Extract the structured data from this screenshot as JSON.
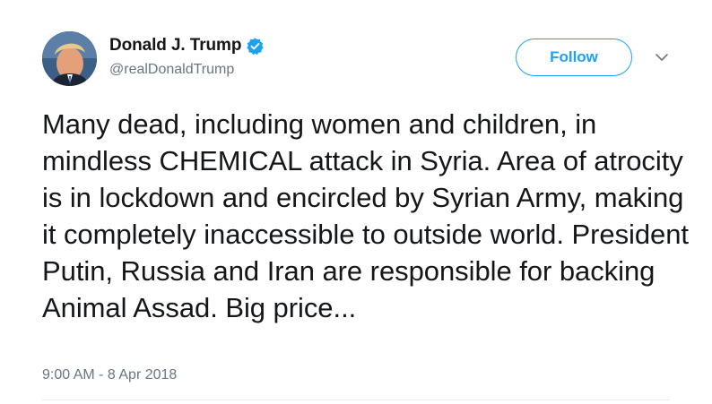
{
  "author": {
    "display_name": "Donald J. Trump",
    "handle": "@realDonaldTrump",
    "verified": true
  },
  "follow_button": {
    "label": "Follow"
  },
  "menu": {
    "icon": "chevron-down-icon"
  },
  "tweet": {
    "text": "Many dead, including women and children, in mindless CHEMICAL attack in Syria. Area of atrocity is in lockdown and encircled by Syrian Army, making it completely inaccessible to outside world. President Putin, Russia and Iran are responsible for backing Animal Assad. Big price...",
    "timestamp": "9:00 AM - 8 Apr 2018"
  },
  "colors": {
    "accent": "#1da1f2",
    "text_primary": "#14171a",
    "text_secondary": "#657786",
    "divider": "#e6ecf0"
  }
}
